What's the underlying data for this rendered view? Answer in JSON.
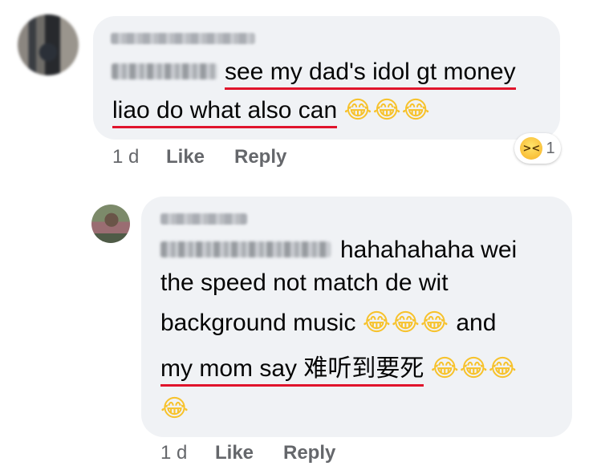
{
  "comment": {
    "reply_to_tag": "Hui Jane",
    "text_line1": "see my dad's idol gt money",
    "text_line2": "liao do what also can",
    "emoji": "😂😂😂",
    "time": "1 d",
    "like_label": "Like",
    "reply_label": "Reply",
    "reaction": {
      "icon": "laughing-squint-emoji",
      "count": "1"
    }
  },
  "reply": {
    "reply_to_tag": "Koe Lih Zheng",
    "text_line1": "hahahahaha wei",
    "text_line2": "the speed not match de wit",
    "text_line3a": "background music",
    "emoji3": "😂😂😂",
    "text_line3b": "and",
    "text_line4": "my mom say 难听到要死",
    "emoji4": "😂😂😂",
    "emoji5": "😂",
    "time": "1 d",
    "like_label": "Like",
    "reply_label": "Reply"
  },
  "colors": {
    "bubble": "#f0f2f5",
    "underline": "#e0142c",
    "meta_text": "#65676b",
    "body_text": "#050505"
  }
}
